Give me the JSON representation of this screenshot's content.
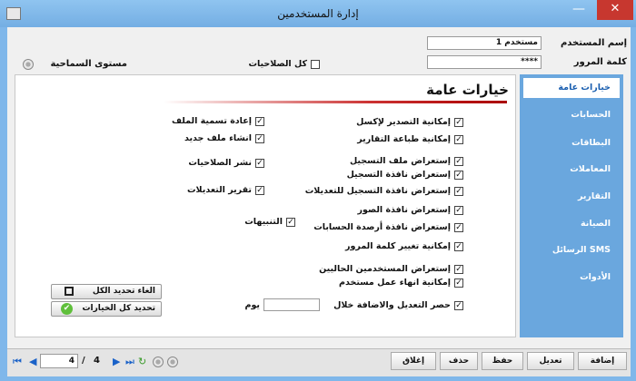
{
  "window": {
    "title": "إدارة المستخدمين",
    "minimize": "—",
    "maximize": "□",
    "close": "✕"
  },
  "user": {
    "username_label": "إسم المستخدم",
    "username_value": "مستخدم 1",
    "password_label": "كلمة المرور",
    "password_value": "****"
  },
  "all_permissions_label": "كل الصلاحيات",
  "tolerance_label": "مستوى السماحية",
  "sidebar": {
    "items": [
      {
        "label": "خيارات عامة"
      },
      {
        "label": "الحسابات"
      },
      {
        "label": "البطاقات"
      },
      {
        "label": "المعاملات"
      },
      {
        "label": "التقارير"
      },
      {
        "label": "الصيانة"
      },
      {
        "label": "الرسائل SMS"
      },
      {
        "label": "الأدوات"
      }
    ]
  },
  "section_title": "خيارات عامة",
  "options_right": [
    {
      "label": "إمكانية التصدير لإكسل",
      "checked": true
    },
    {
      "label": "إمكانية طباعة التقارير",
      "checked": true
    },
    {
      "label": "إستعراض ملف التسجيل",
      "checked": true
    },
    {
      "label": "إستعراض نافذة التسجيل",
      "checked": true
    },
    {
      "label": "إستعراض نافذة التسجيل للتعديلات",
      "checked": true
    },
    {
      "label": "إستعراض نافذة الصور",
      "checked": true
    },
    {
      "label": "إستعراض نافذة أرصدة الحسابات",
      "checked": true
    },
    {
      "label": "إمكانية تغيير كلمة المرور",
      "checked": true
    },
    {
      "label": "إستعراض المستخدمين الحاليين",
      "checked": true
    },
    {
      "label": "إمكانية انهاء عمل مستخدم",
      "checked": true
    },
    {
      "label": "حصر التعديل والاضافة خلال",
      "checked": true
    }
  ],
  "options_left": [
    {
      "label": "إعادة تسمية الملف",
      "checked": true
    },
    {
      "label": "انشاء ملف جديد",
      "checked": true
    },
    {
      "label": "نشر الصلاحيات",
      "checked": true
    },
    {
      "label": "تقرير التعديلات",
      "checked": true
    }
  ],
  "alerts_option": {
    "label": "التنبيهات",
    "checked": true
  },
  "days_unit": "يوم",
  "days_value": "",
  "buttons": {
    "unselect_all": "الغاء تحديد الكل",
    "select_all": "تحديد كل الخيارات"
  },
  "toolbar": {
    "add": "إضافة",
    "edit": "تعديل",
    "save": "حفظ",
    "delete": "حذف",
    "close": "إغلاق"
  },
  "navigator": {
    "current": "4",
    "separator": "/",
    "total": "4"
  },
  "icons": {
    "check": "✓",
    "first": "⏮",
    "prev": "◀",
    "next": "▶",
    "last": "⏭",
    "refresh": "↻",
    "select_all": "✔"
  },
  "colors": {
    "sidebar": "#6aa7de",
    "active_tab_text": "#1b5fb0",
    "title_bar": "#7fb7ea",
    "close_button": "#c7372f",
    "section_line": "#aa0000"
  }
}
